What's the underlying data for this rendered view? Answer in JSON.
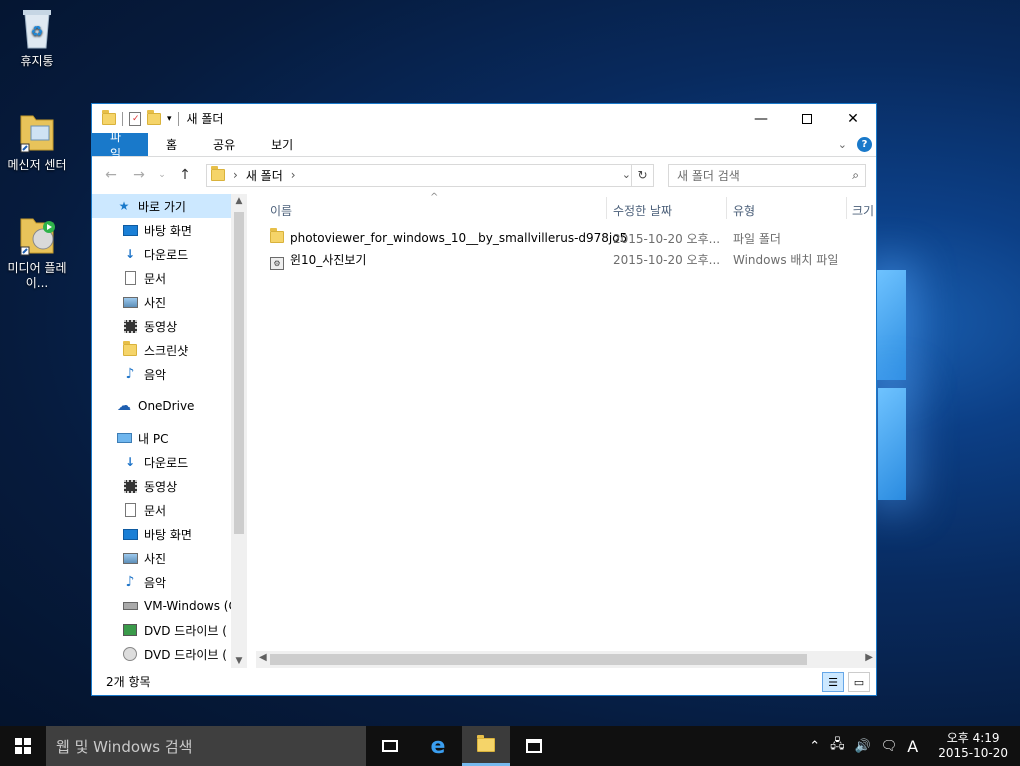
{
  "desktop": {
    "icons": [
      {
        "label": "휴지통"
      },
      {
        "label": "메신저 센터"
      },
      {
        "label": "미디어 플레이..."
      }
    ]
  },
  "window": {
    "title": "새 폴더",
    "ribbon_tabs": [
      "파일",
      "홈",
      "공유",
      "보기"
    ],
    "address": {
      "crumb": "새 폴더"
    },
    "search": {
      "placeholder": "새 폴더 검색"
    },
    "nav": {
      "quick_access": "바로 가기",
      "quick_items": [
        "바탕 화면",
        "다운로드",
        "문서",
        "사진",
        "동영상",
        "스크린샷",
        "음악"
      ],
      "onedrive": "OneDrive",
      "this_pc": "내 PC",
      "pc_items": [
        "다운로드",
        "동영상",
        "문서",
        "바탕 화면",
        "사진",
        "음악",
        "VM-Windows (C",
        "DVD 드라이브 (",
        "DVD 드라이브 ("
      ]
    },
    "columns": {
      "name": "이름",
      "modified": "수정한 날짜",
      "type": "유형",
      "size": "크기"
    },
    "files": [
      {
        "name": "photoviewer_for_windows_10__by_smallvillerus-d978jo5",
        "modified": "2015-10-20 오후...",
        "type": "파일 폴더"
      },
      {
        "name": "윈10_사진보기",
        "modified": "2015-10-20 오후...",
        "type": "Windows 배치 파일"
      }
    ],
    "status": "2개 항목"
  },
  "taskbar": {
    "search_placeholder": "웹 및 Windows 검색",
    "clock_time": "오후 4:19",
    "clock_date": "2015-10-20",
    "ime": "A"
  },
  "colors": {
    "accent": "#1979ca",
    "selected": "#cce8ff"
  }
}
